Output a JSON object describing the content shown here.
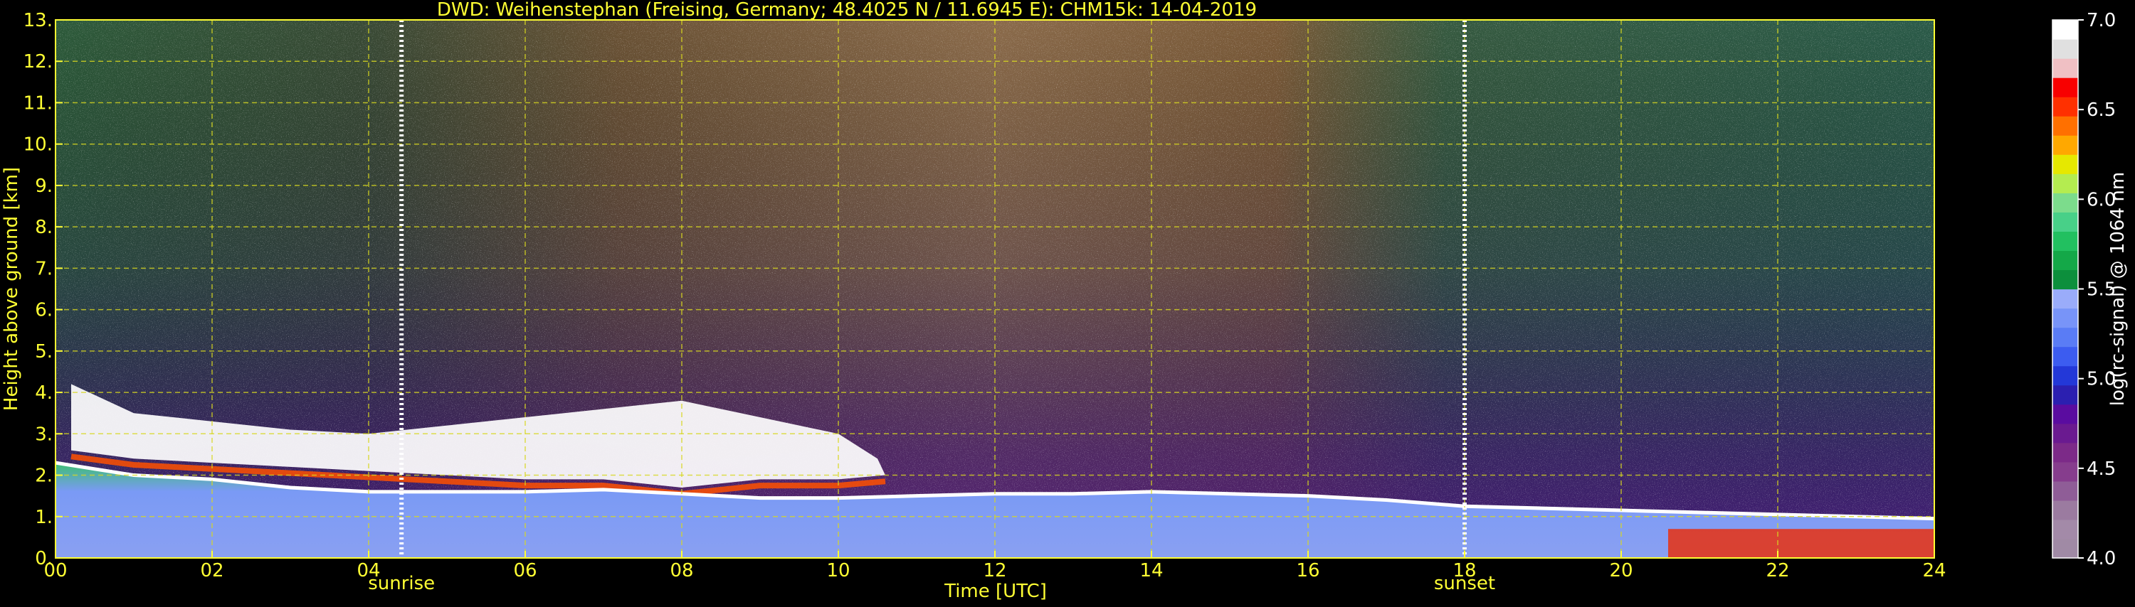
{
  "chart_data": {
    "type": "heatmap",
    "title": "DWD: Weihenstephan (Freising, Germany; 48.4025 N / 11.6945 E):    CHM15k: 14-04-2019",
    "xlabel": "Time [UTC]",
    "ylabel": "Height above ground [km]",
    "xlim": [
      0,
      24
    ],
    "ylim": [
      0,
      13
    ],
    "x_ticks": [
      0,
      2,
      4,
      6,
      8,
      10,
      12,
      14,
      16,
      18,
      20,
      22,
      24
    ],
    "x_tick_labels": [
      "00",
      "02",
      "04",
      "06",
      "08",
      "10",
      "12",
      "14",
      "16",
      "18",
      "20",
      "22",
      "24"
    ],
    "y_ticks": [
      0,
      1,
      2,
      3,
      4,
      5,
      6,
      7,
      8,
      9,
      10,
      11,
      12,
      13
    ],
    "y_tick_labels": [
      "0.",
      "1.",
      "2.",
      "3.",
      "4.",
      "5.",
      "6.",
      "7.",
      "8.",
      "9.",
      "10.",
      "11.",
      "12.",
      "13."
    ],
    "grid": true,
    "annotations": [
      {
        "label": "sunrise",
        "x": 4.42
      },
      {
        "label": "sunset",
        "x": 18.0
      }
    ],
    "colorbar": {
      "label": "log(rc-signal) @ 1064 nm",
      "range": [
        4.0,
        7.0
      ],
      "ticks": [
        4.0,
        4.5,
        5.0,
        5.5,
        6.0,
        6.5,
        7.0
      ],
      "tick_labels": [
        "4.0",
        "4.5",
        "5.0",
        "5.5",
        "6.0",
        "6.5",
        "7.0"
      ],
      "colors": [
        "#a08aa5",
        "#a38aa8",
        "#9b7ba0",
        "#8f5d97",
        "#863d8d",
        "#7c2a88",
        "#6a1a90",
        "#5a0ca0",
        "#2b1fb0",
        "#2338d8",
        "#3c5cf0",
        "#5a7cf5",
        "#7894f8",
        "#9aacfa",
        "#0c8f3c",
        "#14a848",
        "#22c060",
        "#48d088",
        "#7cdc8c",
        "#b4ec50",
        "#e6e800",
        "#ffa800",
        "#ff7000",
        "#ff3000",
        "#f80000",
        "#f0c0c4",
        "#e0e0e0",
        "#ffffff"
      ]
    },
    "boundary_layer_height_km": [
      [
        0.0,
        2.3
      ],
      [
        1.0,
        2.0
      ],
      [
        2.0,
        1.9
      ],
      [
        3.0,
        1.7
      ],
      [
        4.0,
        1.6
      ],
      [
        5.0,
        1.6
      ],
      [
        6.0,
        1.6
      ],
      [
        7.0,
        1.65
      ],
      [
        8.0,
        1.55
      ],
      [
        9.0,
        1.45
      ],
      [
        10.0,
        1.45
      ],
      [
        11.0,
        1.5
      ],
      [
        12.0,
        1.55
      ],
      [
        13.0,
        1.55
      ],
      [
        14.0,
        1.6
      ],
      [
        15.0,
        1.55
      ],
      [
        16.0,
        1.5
      ],
      [
        17.0,
        1.4
      ],
      [
        18.0,
        1.25
      ],
      [
        19.0,
        1.2
      ],
      [
        20.0,
        1.15
      ],
      [
        21.0,
        1.1
      ],
      [
        22.0,
        1.05
      ],
      [
        23.0,
        1.0
      ],
      [
        24.0,
        0.95
      ]
    ]
  }
}
